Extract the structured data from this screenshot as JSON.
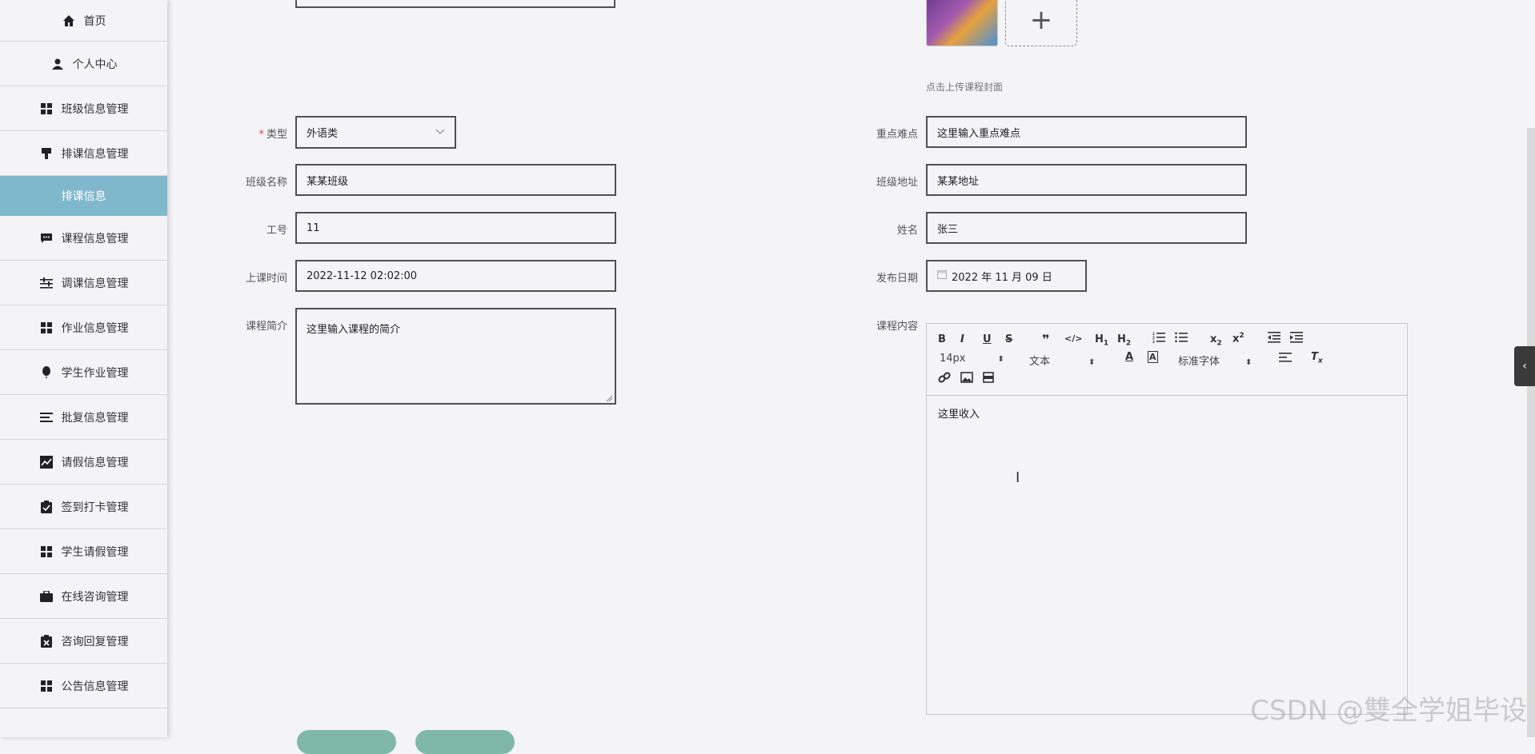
{
  "sidebar": {
    "items": [
      {
        "label": "首页",
        "icon": "home-icon"
      },
      {
        "label": "个人中心",
        "icon": "user-icon"
      },
      {
        "label": "班级信息管理",
        "icon": "grid-icon"
      },
      {
        "label": "排课信息管理",
        "icon": "brush-icon"
      },
      {
        "label": "排课信息",
        "icon": ""
      },
      {
        "label": "课程信息管理",
        "icon": "chat-icon"
      },
      {
        "label": "调课信息管理",
        "icon": "sliders-icon"
      },
      {
        "label": "作业信息管理",
        "icon": "grid-icon"
      },
      {
        "label": "学生作业管理",
        "icon": "balloon-icon"
      },
      {
        "label": "批复信息管理",
        "icon": "list-icon"
      },
      {
        "label": "请假信息管理",
        "icon": "chart-icon"
      },
      {
        "label": "签到打卡管理",
        "icon": "clipboard-check-icon"
      },
      {
        "label": "学生请假管理",
        "icon": "grid-icon"
      },
      {
        "label": "在线咨询管理",
        "icon": "briefcase-icon"
      },
      {
        "label": "咨询回复管理",
        "icon": "clipboard-x-icon"
      },
      {
        "label": "公告信息管理",
        "icon": "grid-icon"
      }
    ]
  },
  "form": {
    "upload_hint": "点击上传课程封面",
    "type_label": "类型",
    "type_value": "外语类",
    "class_name_label": "班级名称",
    "class_name_value": "某某班级",
    "job_no_label": "工号",
    "job_no_value": "11",
    "class_time_label": "上课时间",
    "class_time_value": "2022-11-12 02:02:00",
    "intro_label": "课程简介",
    "intro_value": "这里输入课程的简介",
    "key_points_label": "重点难点",
    "key_points_value": "这里输入重点难点",
    "class_address_label": "班级地址",
    "class_address_value": "某某地址",
    "name_label": "姓名",
    "name_value": "张三",
    "publish_date_label": "发布日期",
    "publish_date_value": "2022 年 11 月 09 日",
    "content_label": "课程内容",
    "content_value": "这里收入"
  },
  "editor_toolbar": {
    "font_size": "14px",
    "text_type": "文本",
    "font_family": "标准字体"
  },
  "watermark": "CSDN @雙全学姐毕设"
}
